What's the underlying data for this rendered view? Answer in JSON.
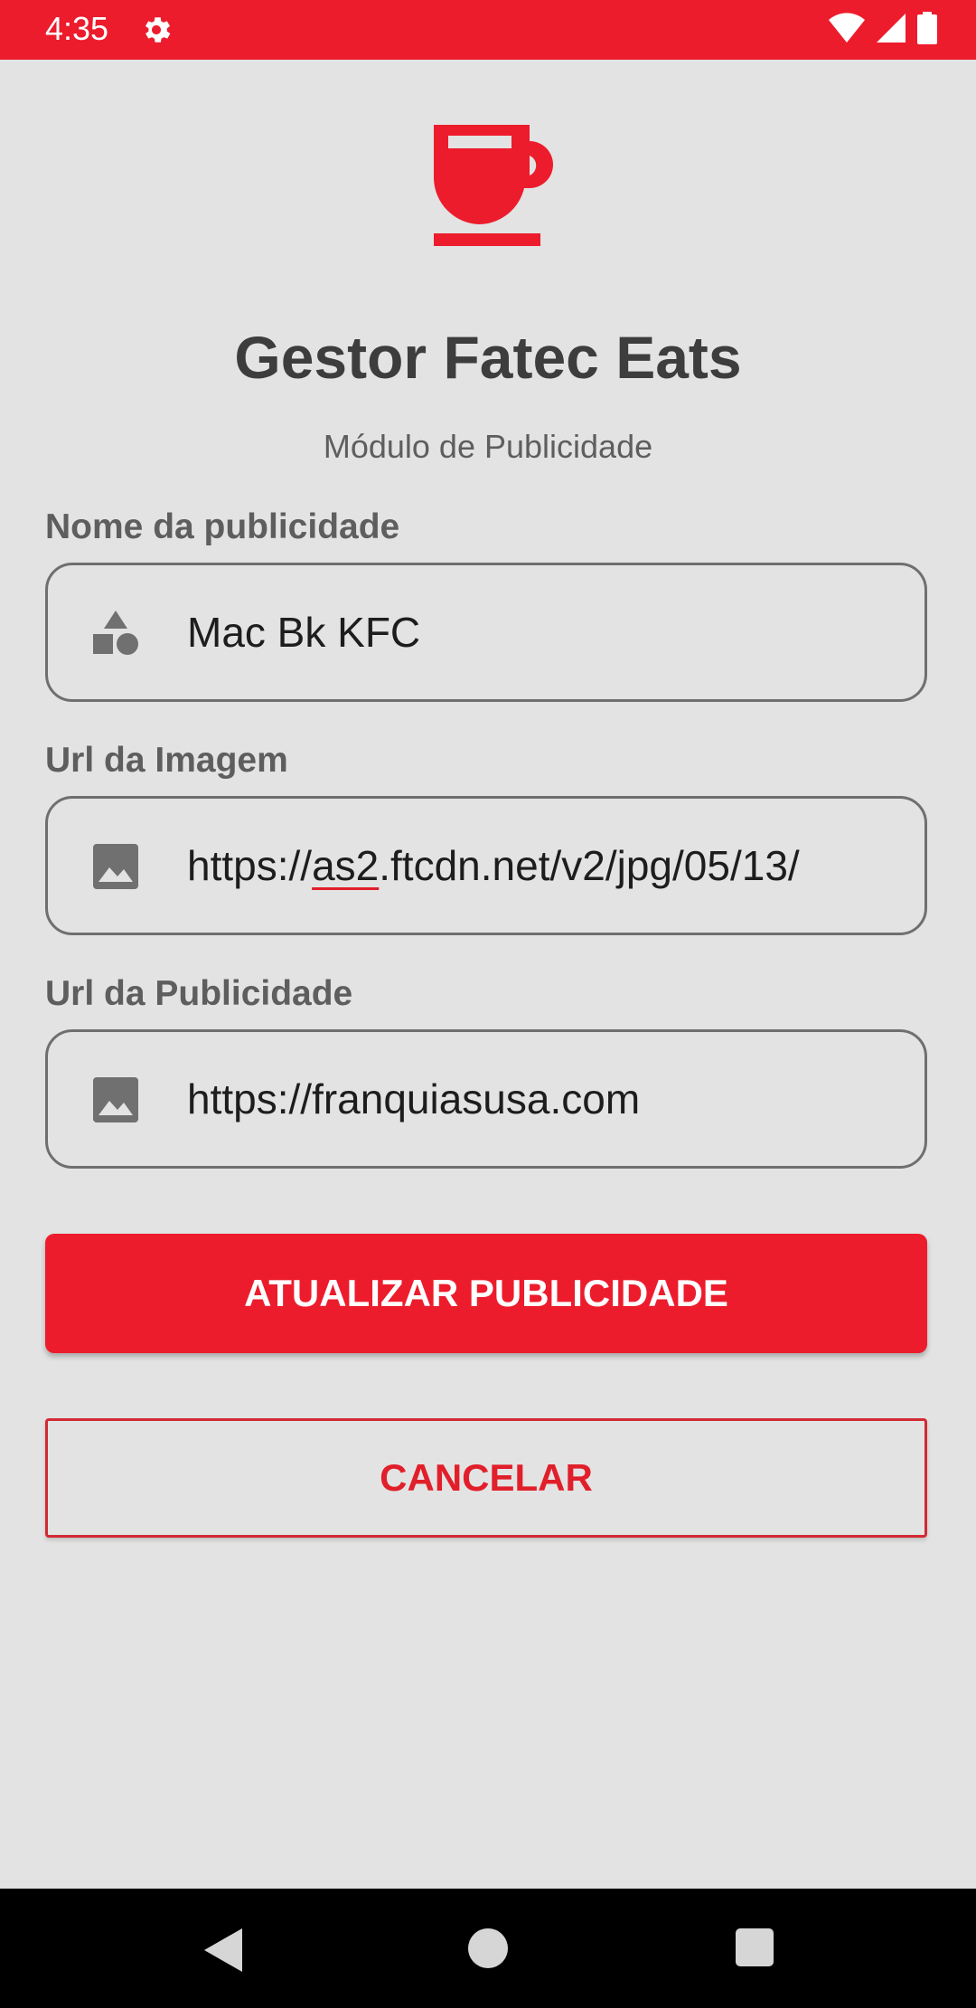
{
  "status_bar": {
    "time": "4:35"
  },
  "header": {
    "title": "Gestor Fatec Eats",
    "subtitle": "Módulo de Publicidade"
  },
  "form": {
    "name": {
      "label": "Nome da publicidade",
      "value": "Mac Bk KFC",
      "icon": "shapes-icon"
    },
    "image_url": {
      "label": "Url da Imagem",
      "value_prefix": "https://",
      "value_underlined": "as2",
      "value_suffix": ".ftcdn.net/v2/jpg/05/13/",
      "icon": "image-icon"
    },
    "ad_url": {
      "label": "Url da Publicidade",
      "value": "https://franquiasusa.com",
      "icon": "image-icon"
    }
  },
  "buttons": {
    "update_label": "ATUALIZAR PUBLICIDADE",
    "cancel_label": "CANCELAR"
  },
  "colors": {
    "accent": "#ec1c2c",
    "background": "#e3e3e3",
    "text_dark": "#3d3d3d"
  }
}
